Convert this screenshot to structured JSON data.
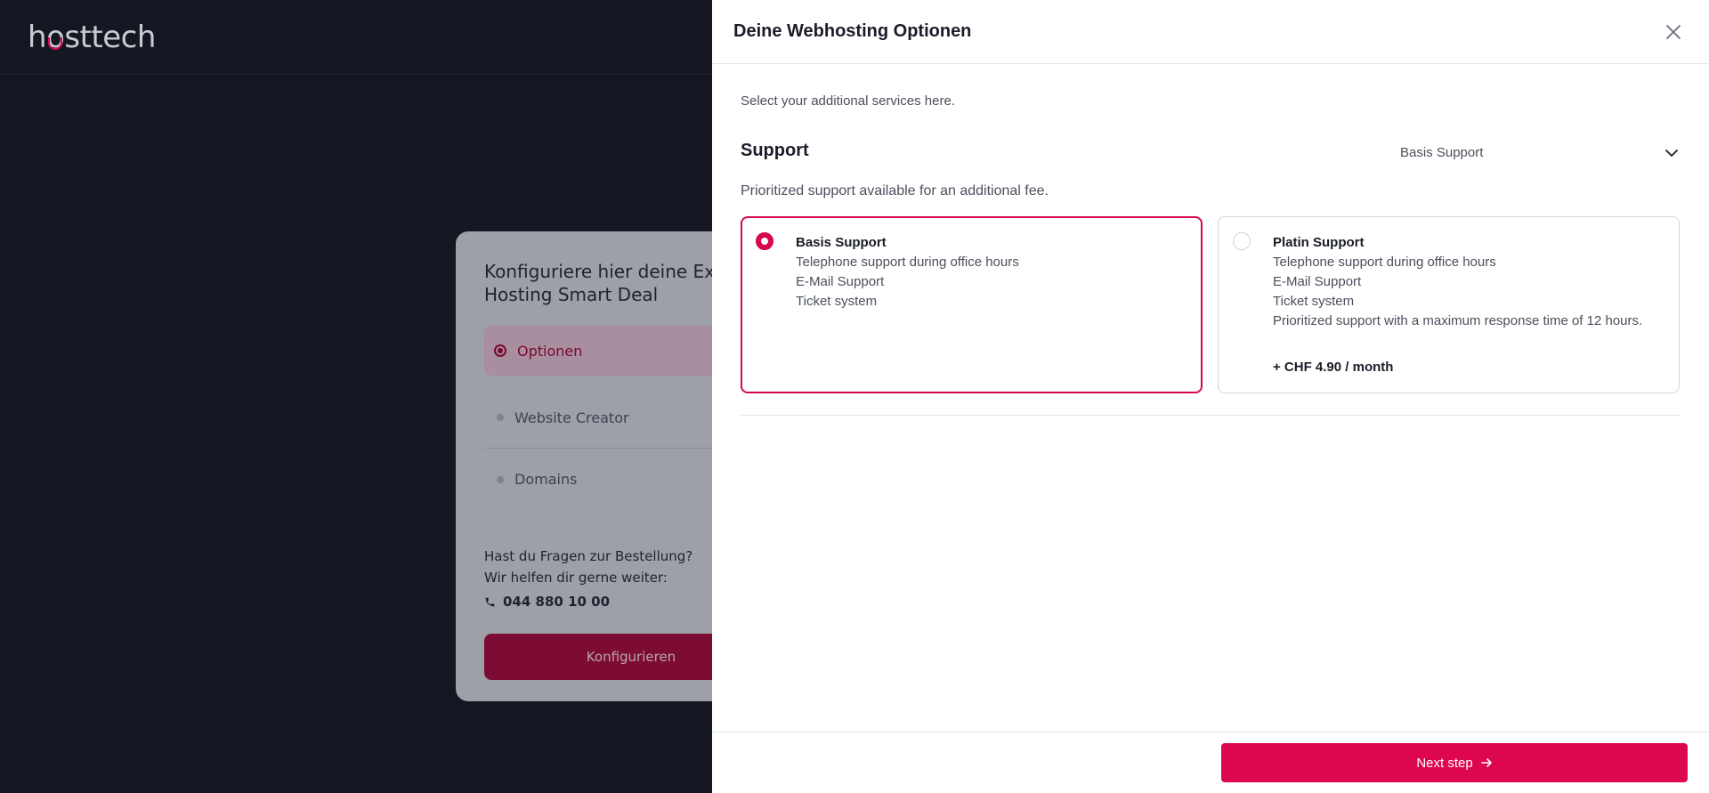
{
  "brand": {
    "logo_pre": "h",
    "logo_o": "o",
    "logo_post": "sttech"
  },
  "config": {
    "title": "Konfiguriere hier deine Extras zu unserem Hosting Smart Deal",
    "steps": [
      {
        "label": "Optionen",
        "active": true
      },
      {
        "label": "Website Creator",
        "active": false
      },
      {
        "label": "Domains",
        "active": false
      }
    ],
    "help_line1": "Hast du Fragen zur Bestellung?",
    "help_line2": "Wir helfen dir gerne weiter:",
    "phone": "044 880 10 00",
    "button_label": "Konfigurieren"
  },
  "drawer": {
    "title": "Deine Webhosting Optionen",
    "intro": "Select your additional services here.",
    "section": {
      "title": "Support",
      "selected_value": "Basis Support",
      "description": "Prioritized support available for an additional fee.",
      "options": [
        {
          "name": "Basis Support",
          "lines": [
            "Telephone support during office hours",
            "E-Mail Support",
            "Ticket system"
          ],
          "price": "",
          "selected": true
        },
        {
          "name": "Platin Support",
          "lines": [
            "Telephone support during office hours",
            "E-Mail Support",
            "Ticket system",
            "Prioritized support with a maximum response time of 12 hours."
          ],
          "price": "+ CHF 4.90 / month",
          "selected": false
        }
      ]
    },
    "next_label": "Next step"
  },
  "colors": {
    "accent": "#dd0651",
    "backdrop": "#141722"
  }
}
